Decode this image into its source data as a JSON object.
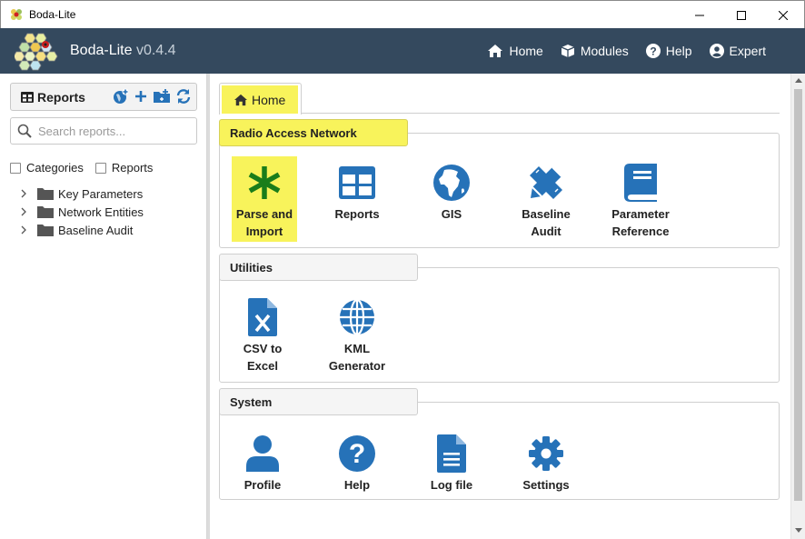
{
  "window": {
    "title": "Boda-Lite"
  },
  "header": {
    "brand": "Boda-Lite",
    "version": "v0.4.4",
    "nav": [
      {
        "label": "Home",
        "icon": "home-icon"
      },
      {
        "label": "Modules",
        "icon": "cube-icon"
      },
      {
        "label": "Help",
        "icon": "question-circle-icon"
      },
      {
        "label": "Expert",
        "icon": "user-circle-icon"
      }
    ]
  },
  "sidebar": {
    "title": "Reports",
    "search_placeholder": "Search reports...",
    "filters": [
      {
        "label": "Categories",
        "checked": false
      },
      {
        "label": "Reports",
        "checked": false
      }
    ],
    "tree": [
      {
        "label": "Key Parameters"
      },
      {
        "label": "Network Entities"
      },
      {
        "label": "Baseline Audit"
      }
    ]
  },
  "main": {
    "tab": "Home",
    "sections": [
      {
        "title": "Radio Access Network",
        "tiles": [
          {
            "label_line1": "Parse and",
            "label_line2": "Import",
            "icon": "asterisk-icon"
          },
          {
            "label_line1": "Reports",
            "label_line2": "",
            "icon": "table-icon"
          },
          {
            "label_line1": "GIS",
            "label_line2": "",
            "icon": "globe-africa-icon"
          },
          {
            "label_line1": "Baseline",
            "label_line2": "Audit",
            "icon": "pencil-ruler-icon"
          },
          {
            "label_line1": "Parameter",
            "label_line2": "Reference",
            "icon": "book-icon"
          }
        ]
      },
      {
        "title": "Utilities",
        "tiles": [
          {
            "label_line1": "CSV to",
            "label_line2": "Excel",
            "icon": "file-excel-icon"
          },
          {
            "label_line1": "KML",
            "label_line2": "Generator",
            "icon": "globe-icon"
          }
        ]
      },
      {
        "title": "System",
        "tiles": [
          {
            "label_line1": "Profile",
            "label_line2": "",
            "icon": "user-icon"
          },
          {
            "label_line1": "Help",
            "label_line2": "",
            "icon": "question-circle-icon"
          },
          {
            "label_line1": "Log file",
            "label_line2": "",
            "icon": "file-alt-icon"
          },
          {
            "label_line1": "Settings",
            "label_line2": "",
            "icon": "cog-icon"
          }
        ]
      }
    ]
  },
  "colors": {
    "header_bg": "#34495e",
    "icon_blue": "#2672b8",
    "icon_green": "#1a7d1a",
    "highlight": "#f8f35b"
  }
}
